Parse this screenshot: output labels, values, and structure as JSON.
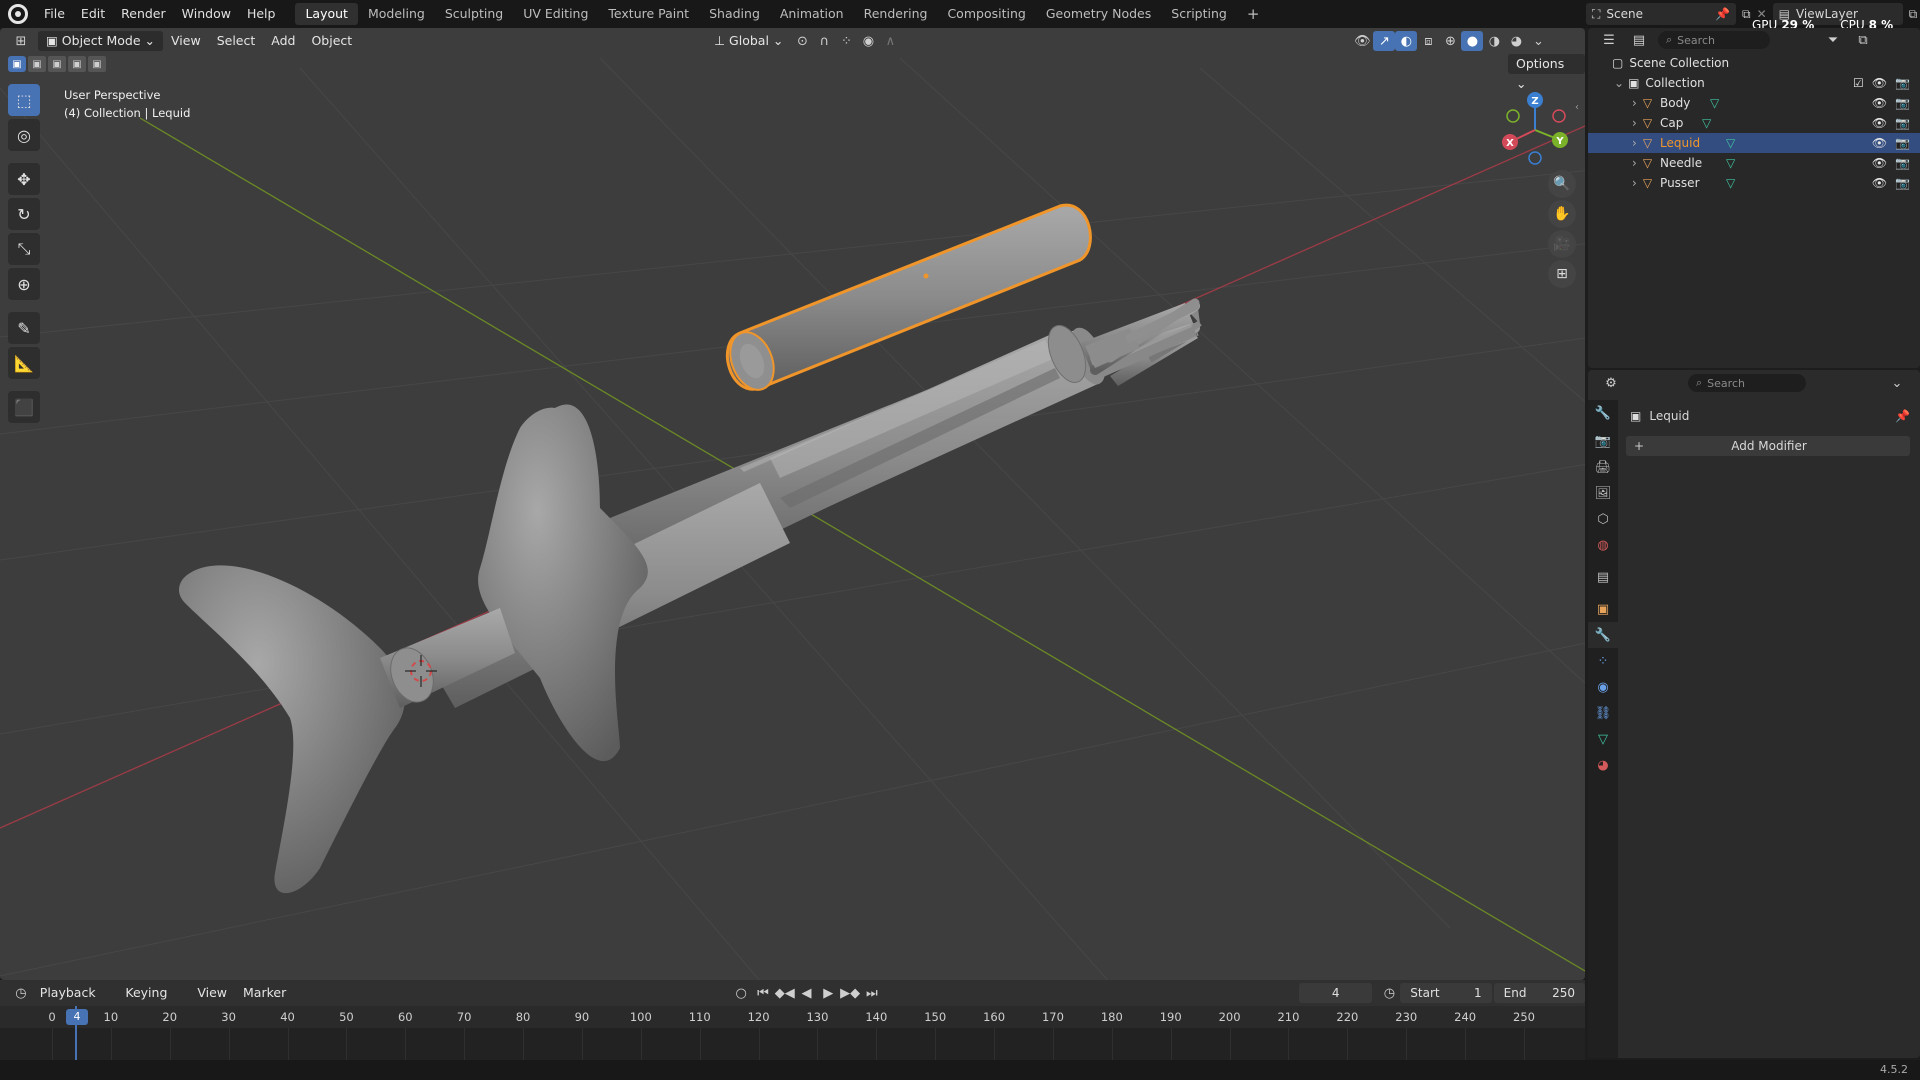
{
  "topbar": {
    "menus": [
      "File",
      "Edit",
      "Render",
      "Window",
      "Help"
    ],
    "workspaces": [
      "Layout",
      "Modeling",
      "Sculpting",
      "UV Editing",
      "Texture Paint",
      "Shading",
      "Animation",
      "Rendering",
      "Compositing",
      "Geometry Nodes",
      "Scripting"
    ],
    "active_workspace": "Layout",
    "add_tab": "+",
    "scene_name": "Scene",
    "view_layer": "ViewLayer",
    "gpu_label": "GPU",
    "gpu_value": "29 %",
    "cpu_label": "CPU",
    "cpu_value": "8 %"
  },
  "viewport": {
    "mode": "Object Mode",
    "menus": [
      "View",
      "Select",
      "Add",
      "Object"
    ],
    "orientation": "Global",
    "options_label": "Options",
    "overlay_line1": "User Perspective",
    "overlay_line2": "(4) Collection | Lequid",
    "gizmo_axes": {
      "x": "X",
      "y": "Y",
      "z": "Z"
    },
    "colors": {
      "background": "#3d3d3d",
      "grid": "#484848",
      "x_axis": "#9c3b46",
      "y_axis": "#6b8a25",
      "selection": "#f0952a",
      "mesh": "#8e8e8e"
    }
  },
  "toolbar": {
    "tools": [
      "select-box",
      "cursor",
      "move",
      "rotate",
      "scale",
      "transform",
      "annotate",
      "measure",
      "add-cube"
    ]
  },
  "timeline": {
    "menus": [
      "Playback",
      "Keying",
      "View",
      "Marker"
    ],
    "current_frame": "4",
    "start_label": "Start",
    "start_value": "1",
    "end_label": "End",
    "end_value": "250",
    "ticks": [
      "0",
      "10",
      "20",
      "30",
      "40",
      "50",
      "60",
      "70",
      "80",
      "90",
      "100",
      "110",
      "120",
      "130",
      "140",
      "150",
      "160",
      "170",
      "180",
      "190",
      "200",
      "210",
      "220",
      "230",
      "240",
      "250"
    ],
    "playhead_label": "4"
  },
  "outliner": {
    "search_placeholder": "Search",
    "scene_collection": "Scene Collection",
    "collection": "Collection",
    "objects": [
      {
        "name": "Body",
        "selected": false
      },
      {
        "name": "Cap",
        "selected": false
      },
      {
        "name": "Lequid",
        "selected": true
      },
      {
        "name": "Needle",
        "selected": false
      },
      {
        "name": "Pusser",
        "selected": false
      }
    ]
  },
  "properties": {
    "search_placeholder": "Search",
    "object_name": "Lequid",
    "add_modifier": "Add Modifier",
    "active_tab": "modifiers"
  },
  "statusbar": {
    "version": "4.5.2"
  }
}
